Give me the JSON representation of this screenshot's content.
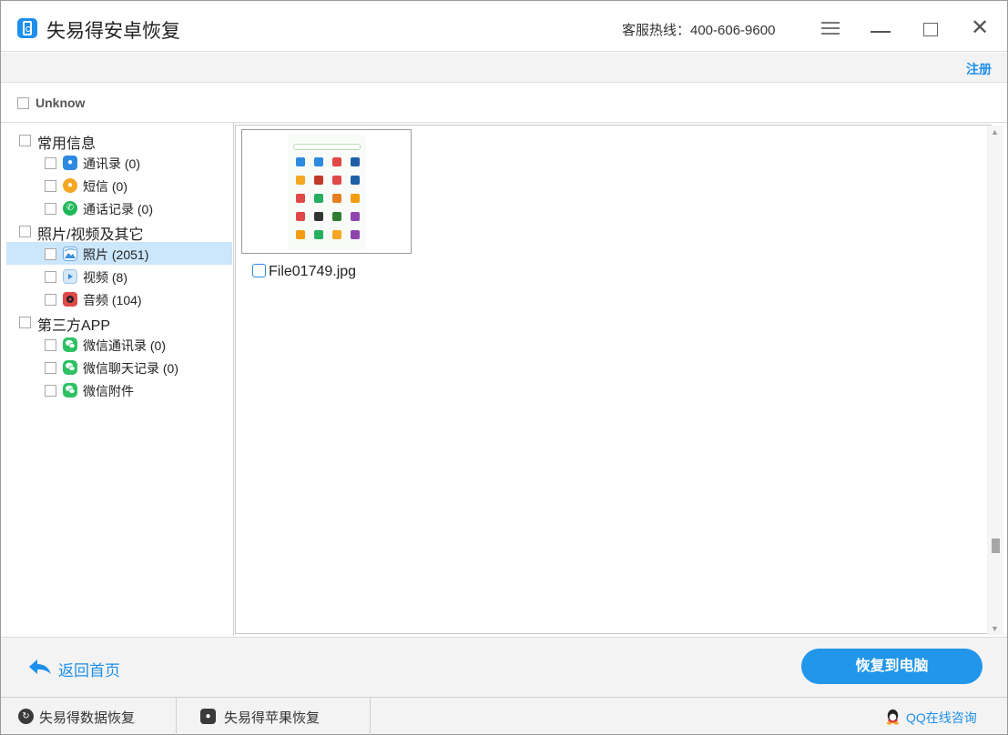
{
  "app": {
    "title": "失易得安卓恢复",
    "hotline": "客服热线：400-606-9600"
  },
  "header": {
    "register_label": "注册"
  },
  "filter": {
    "unknow_label": "Unknow"
  },
  "tree": {
    "categories": [
      {
        "label": "常用信息",
        "items": [
          {
            "label": "通讯录 (0)",
            "icon": "contacts-icon"
          },
          {
            "label": "短信 (0)",
            "icon": "sms-icon"
          },
          {
            "label": "通话记录 (0)",
            "icon": "call-log-icon"
          }
        ]
      },
      {
        "label": "照片/视频及其它",
        "items": [
          {
            "label": "照片 (2051)",
            "icon": "photo-icon",
            "selected": true
          },
          {
            "label": "视频 (8)",
            "icon": "video-icon"
          },
          {
            "label": "音频 (104)",
            "icon": "audio-icon"
          }
        ]
      },
      {
        "label": "第三方APP",
        "items": [
          {
            "label": "微信通讯录 (0)",
            "icon": "wechat-icon"
          },
          {
            "label": "微信聊天记录 (0)",
            "icon": "wechat-icon"
          },
          {
            "label": "微信附件",
            "icon": "wechat-icon"
          }
        ]
      }
    ]
  },
  "content": {
    "files": [
      {
        "name": "File01749.jpg"
      }
    ]
  },
  "actions": {
    "back_label": "返回首页",
    "recover_label": "恢复到电脑"
  },
  "footer": {
    "tabs": [
      {
        "label": "失易得数据恢复"
      },
      {
        "label": "失易得苹果恢复"
      }
    ],
    "qq_label": "QQ在线咨询"
  },
  "colors": {
    "accent": "#1e8fea",
    "selected_row": "#cce6fb",
    "button": "#2196ea"
  }
}
